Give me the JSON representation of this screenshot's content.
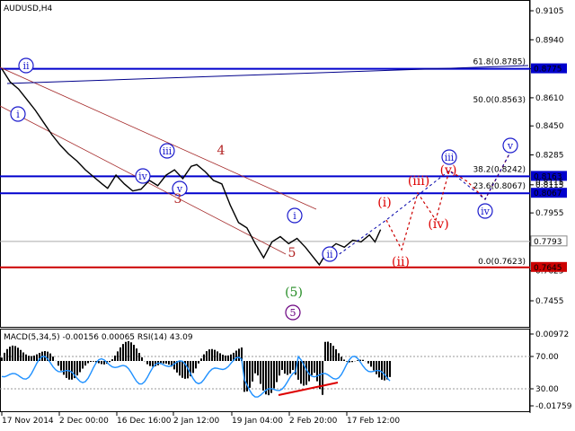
{
  "chart_data": {
    "type": "line",
    "title": "AUDUSD,H4",
    "main_panel": {
      "y_ticks": [
        "0.9105",
        "0.8940",
        "0.8775",
        "0.8610",
        "0.8450",
        "0.8285",
        "0.8115",
        "0.7955",
        "0.7793",
        "0.7625",
        "0.7455"
      ],
      "ylim": [
        0.7372,
        0.9182
      ],
      "price_path": [
        [
          0.0,
          0.8775
        ],
        [
          1.5,
          0.87
        ],
        [
          3,
          0.866
        ],
        [
          4.5,
          0.86
        ],
        [
          6,
          0.854
        ],
        [
          7.5,
          0.847
        ],
        [
          9,
          0.84
        ],
        [
          10.5,
          0.834
        ],
        [
          12,
          0.829
        ],
        [
          13.5,
          0.825
        ],
        [
          15,
          0.82
        ],
        [
          16.5,
          0.816
        ],
        [
          18,
          0.812
        ],
        [
          19,
          0.8095
        ],
        [
          20.5,
          0.817
        ],
        [
          22,
          0.812
        ],
        [
          23.5,
          0.808
        ],
        [
          25,
          0.809
        ],
        [
          26.5,
          0.814
        ],
        [
          28,
          0.811
        ],
        [
          29.5,
          0.817
        ],
        [
          31,
          0.82
        ],
        [
          32.5,
          0.815
        ],
        [
          34,
          0.822
        ],
        [
          35,
          0.823
        ],
        [
          36.5,
          0.819
        ],
        [
          38,
          0.814
        ],
        [
          39.5,
          0.812
        ],
        [
          41,
          0.8
        ],
        [
          42.5,
          0.79
        ],
        [
          44,
          0.787
        ],
        [
          45.5,
          0.778
        ],
        [
          47,
          0.77
        ],
        [
          48.5,
          0.779
        ],
        [
          50,
          0.782
        ],
        [
          51.5,
          0.778
        ],
        [
          53,
          0.781
        ],
        [
          54.5,
          0.776
        ],
        [
          56,
          0.77
        ],
        [
          57,
          0.766
        ],
        [
          58.5,
          0.774
        ],
        [
          60,
          0.778
        ],
        [
          61.5,
          0.776
        ],
        [
          63,
          0.78
        ],
        [
          64.5,
          0.779
        ],
        [
          66,
          0.783
        ],
        [
          67,
          0.779
        ],
        [
          68,
          0.786
        ]
      ],
      "resistance_levels": [
        {
          "value": "0.8775",
          "label": "61.8(0.8785)"
        },
        {
          "value": "0.8163",
          "label": "38.2(0.8242)"
        },
        {
          "value": "0.8067",
          "label": "23.6(0.8067)"
        }
      ],
      "support_level": {
        "value": "0.7645",
        "label": "0.0(0.7623)"
      },
      "current_price": "0.7793",
      "extra_price_label": "0.8115",
      "fib_labels": [
        "50.0(0.8563)"
      ],
      "wave_labels": {
        "blue_circled": [
          "ii",
          "i",
          "iii",
          "iv",
          "v",
          "i",
          "ii",
          "iii",
          "iv",
          "v"
        ],
        "red": [
          "4",
          "3",
          "5"
        ],
        "red_paren": [
          "(i)",
          "(ii)",
          "(iii)",
          "(iv)",
          "(v)"
        ],
        "green_paren": [
          "(5)"
        ],
        "purple_circled": [
          "5"
        ]
      }
    },
    "sub_panel": {
      "title": "MACD(5,34,5) -0.00156 0.00065 RSI(14) 43.09",
      "y_ticks": [
        "0.00972",
        "70.00",
        "30.00",
        "-0.01759"
      ]
    },
    "x_labels": [
      "17 Nov 2014",
      "2 Dec 00:00",
      "16 Dec 16:00",
      "2 Jan 12:00",
      "19 Jan 04:00",
      "2 Feb 20:00",
      "17 Feb 12:00"
    ]
  }
}
